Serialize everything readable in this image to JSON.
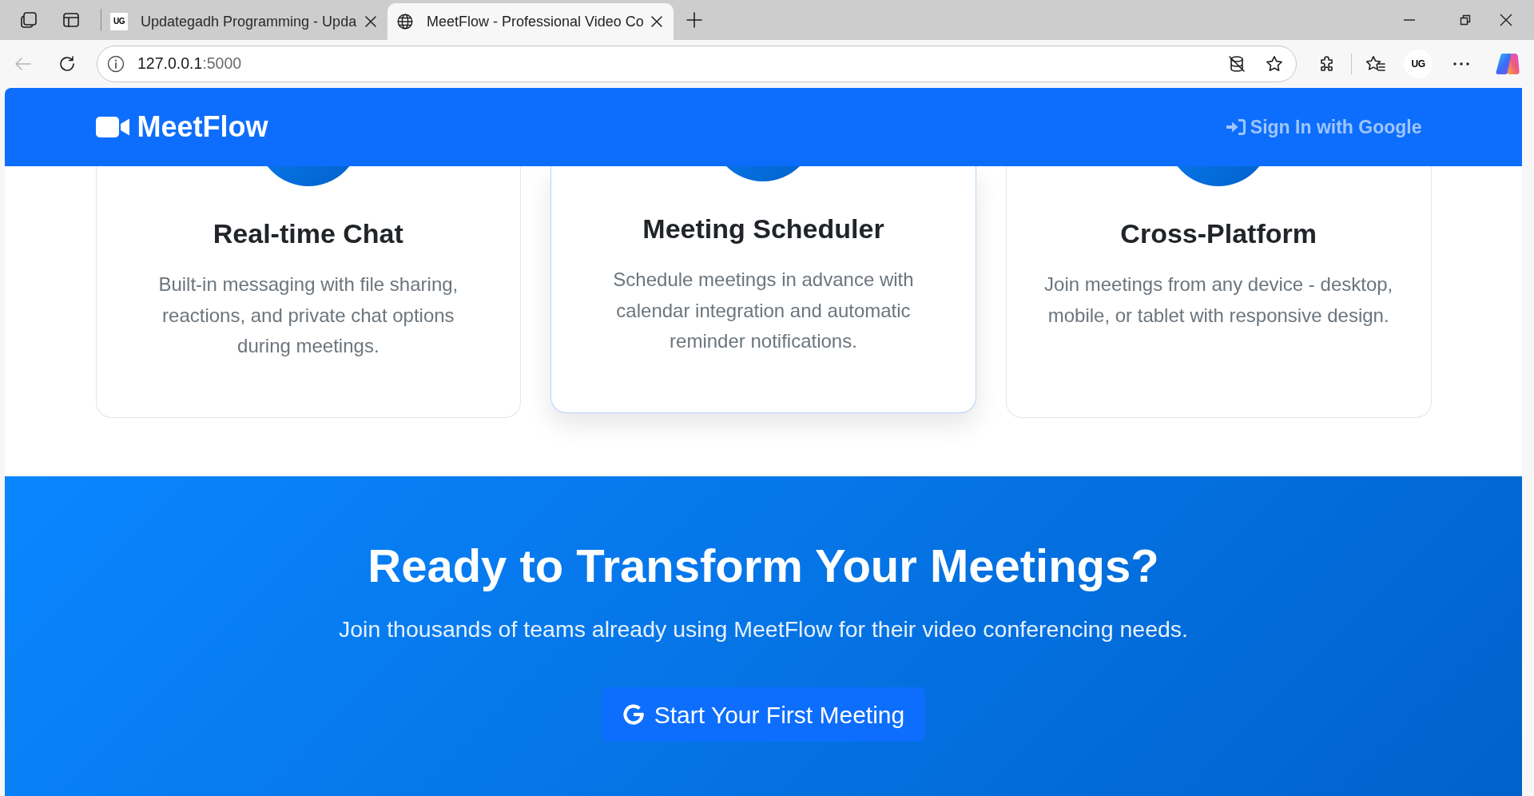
{
  "browser": {
    "tabs": [
      {
        "logo_text": "UG",
        "title": "Updategadh Programming - Upda",
        "selected": false
      },
      {
        "title": "MeetFlow - Professional Video Co",
        "selected": true
      }
    ],
    "address": {
      "host": "127.0.0.1",
      "port": ":5000"
    },
    "profile": "UG"
  },
  "navbar": {
    "brand": "MeetFlow",
    "sign_in": "Sign In with Google"
  },
  "features": [
    {
      "title": "Real-time Chat",
      "description": "Built-in messaging with file sharing, reactions, and private chat options during meetings.",
      "hovered": false
    },
    {
      "title": "Meeting Scheduler",
      "description": "Schedule meetings in advance with calendar integration and automatic reminder notifications.",
      "hovered": true
    },
    {
      "title": "Cross-Platform",
      "description": "Join meetings from any device - desktop, mobile, or tablet with responsive design.",
      "hovered": false
    }
  ],
  "cta": {
    "heading": "Ready to Transform Your Meetings?",
    "text": "Join thousands of teams already using MeetFlow for their video conferencing needs.",
    "button": "Start Your First Meeting"
  }
}
